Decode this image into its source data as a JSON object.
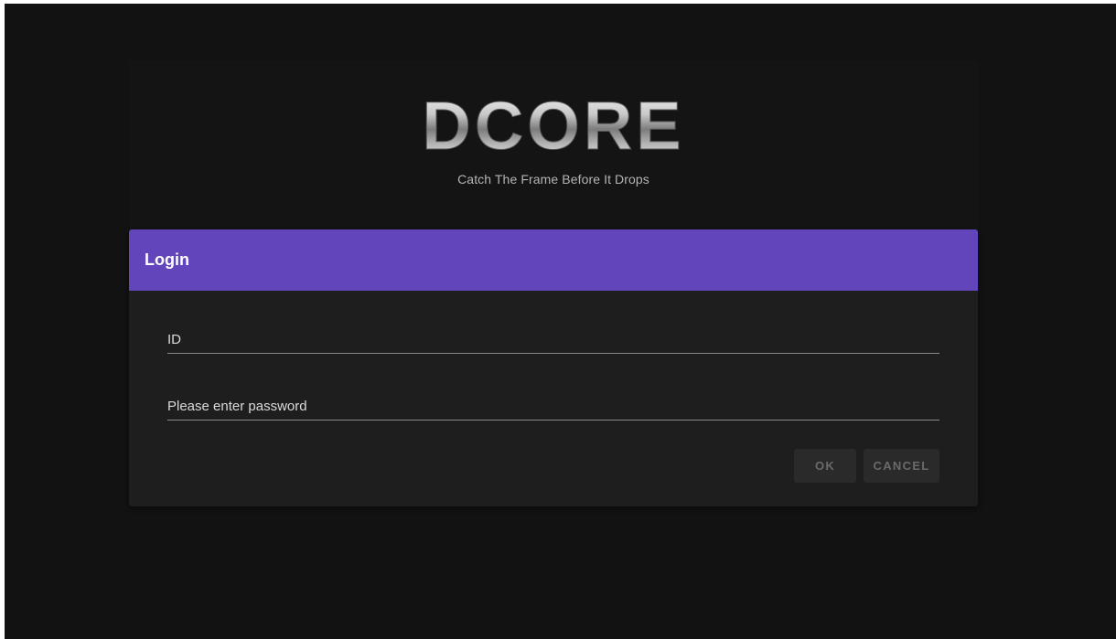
{
  "brand": {
    "logo_text": "DCORE",
    "tagline": "Catch The Frame Before It Drops"
  },
  "login": {
    "title": "Login",
    "id_placeholder": "ID",
    "password_placeholder": "Please enter password",
    "ok_label": "OK",
    "cancel_label": "CANCEL"
  },
  "colors": {
    "background": "#121212",
    "card": "#1e1e1e",
    "header_accent": "#6244bb",
    "button_bg": "#2a2a2a",
    "button_text_disabled": "#6a6a6a"
  }
}
